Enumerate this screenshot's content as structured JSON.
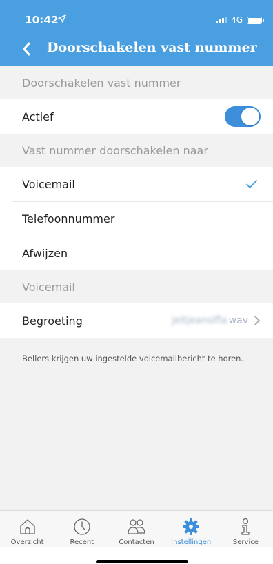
{
  "status_bar": {
    "time": "10:42",
    "network": "4G"
  },
  "nav": {
    "back_icon": "chevron-left-icon",
    "title": "Doorschakelen vast nummer"
  },
  "sections": {
    "doorschakelen_header": "Doorschakelen vast nummer",
    "actief_label": "Actief",
    "actief_on": true,
    "naar_header": "Vast nummer doorschakelen naar",
    "options": [
      {
        "label": "Voicemail",
        "selected": true
      },
      {
        "label": "Telefoonnummer",
        "selected": false
      },
      {
        "label": "Afwijzen",
        "selected": false
      }
    ],
    "voicemail_header": "Voicemail",
    "begroeting_label": "Begroeting",
    "begroeting_value": "jeltjeanslfla",
    "begroeting_ext": "wav",
    "note": "Bellers krijgen uw ingestelde voicemailbericht te horen."
  },
  "tabs": [
    {
      "label": "Overzicht",
      "icon": "home-icon",
      "active": false
    },
    {
      "label": "Recent",
      "icon": "clock-icon",
      "active": false
    },
    {
      "label": "Contacten",
      "icon": "contacts-icon",
      "active": false
    },
    {
      "label": "Instellingen",
      "icon": "gear-icon",
      "active": true
    },
    {
      "label": "Service",
      "icon": "info-icon",
      "active": false
    }
  ],
  "colors": {
    "header": "#4a9fe0",
    "accent": "#3d8fdb",
    "background": "#f2f2f2"
  }
}
